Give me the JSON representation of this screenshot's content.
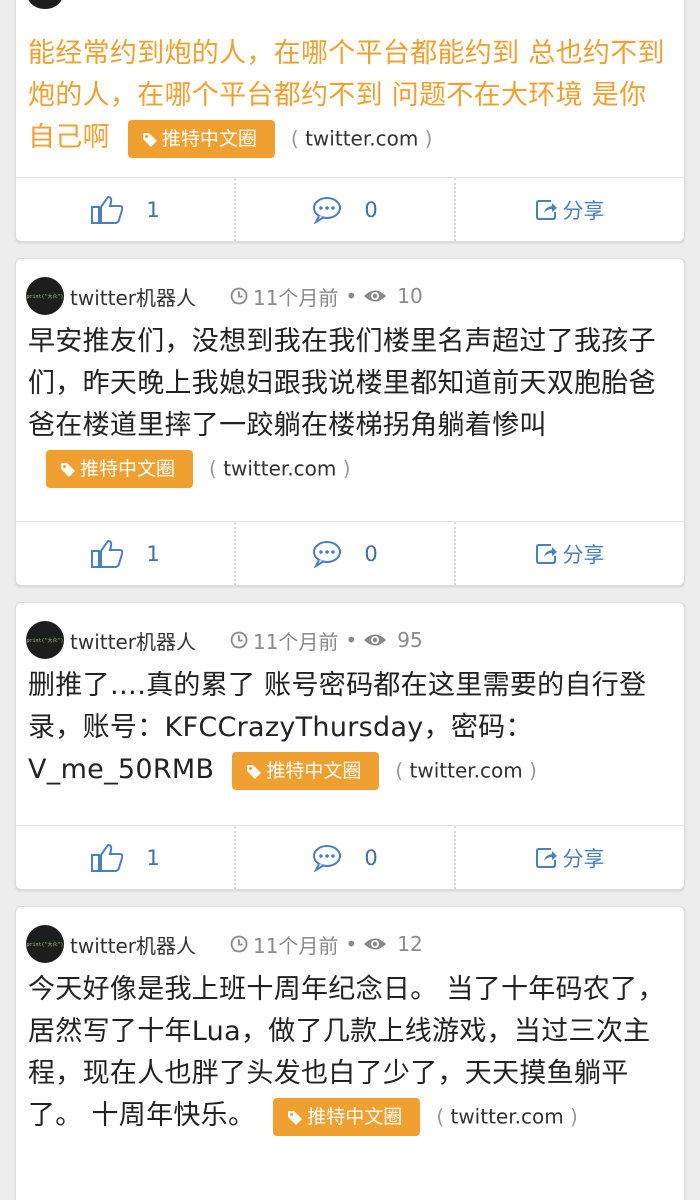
{
  "posts": [
    {
      "author": "",
      "time": "",
      "views": "",
      "text": "能经常约到炮的人，在哪个平台都能约到 总也约不到炮的人，在哪个平台都约不到 问题不在大环境 是你自己啊",
      "tag": "推特中文圈",
      "source": "twitter.com",
      "likes": "1",
      "comments": "0",
      "share_label": "分享"
    },
    {
      "author": "twitter机器人",
      "time": "11个月前",
      "views": "10",
      "text": "早安推友们，没想到我在我们楼里名声超过了我孩子们，昨天晚上我媳妇跟我说楼里都知道前天双胞胎爸爸在楼道里摔了一跤躺在楼梯拐角躺着惨叫",
      "tag": "推特中文圈",
      "source": "twitter.com",
      "likes": "1",
      "comments": "0",
      "share_label": "分享"
    },
    {
      "author": "twitter机器人",
      "time": "11个月前",
      "views": "95",
      "text": "删推了….真的累了 账号密码都在这里需要的自行登录，账号：KFCCrazyThursday，密码：V_me_50RMB",
      "tag": "推特中文圈",
      "source": "twitter.com",
      "likes": "1",
      "comments": "0",
      "share_label": "分享"
    },
    {
      "author": "twitter机器人",
      "time": "11个月前",
      "views": "12",
      "text": "今天好像是我上班十周年纪念日。 当了十年码农了，居然写了十年Lua，做了几款上线游戏，当过三次主程，现在人也胖了头发也白了少了，天天摸鱼躺平了。 十周年快乐。",
      "tag": "推特中文圈",
      "source": "twitter.com",
      "likes": "",
      "comments": "",
      "share_label": ""
    }
  ],
  "avatar_text": "print(\"大众\")",
  "colors": {
    "accent_orange": "#f0a030",
    "action_blue": "#4a7fc0",
    "meta_gray": "#8a8a8a"
  },
  "icons": [
    "thumbs-up-icon",
    "comment-icon",
    "share-icon",
    "clock-icon",
    "eye-icon",
    "tag-icon"
  ]
}
